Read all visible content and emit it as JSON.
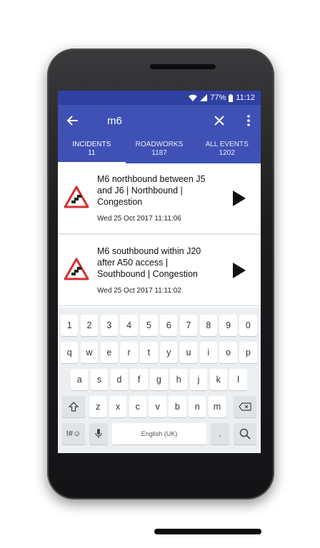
{
  "status": {
    "battery": "77%",
    "time": "11:12"
  },
  "appbar": {
    "query": "m6",
    "back_icon": "arrow-left-icon",
    "clear_icon": "close-icon",
    "more_icon": "more-vert-icon"
  },
  "tabs": [
    {
      "label": "INCIDENTS",
      "count": "11"
    },
    {
      "label": "ROADWORKS",
      "count": "1187"
    },
    {
      "label": "ALL EVENTS",
      "count": "1202"
    }
  ],
  "incidents": [
    {
      "title": "M6 northbound between J5 and J6 | Northbound | Congestion",
      "timestamp": "Wed 25 Oct 2017 11:11:06",
      "icon": "queue-warning-icon"
    },
    {
      "title": "M6 southbound within J20 after A50 access | Southbound | Congestion",
      "timestamp": "Wed 25 Oct 2017 11:11:02",
      "icon": "queue-warning-icon"
    }
  ],
  "keyboard": {
    "row1": [
      "1",
      "2",
      "3",
      "4",
      "5",
      "6",
      "7",
      "8",
      "9",
      "0"
    ],
    "row2": [
      "q",
      "w",
      "e",
      "r",
      "t",
      "y",
      "u",
      "i",
      "o",
      "p"
    ],
    "row3": [
      "a",
      "s",
      "d",
      "f",
      "g",
      "h",
      "j",
      "k",
      "l"
    ],
    "row4": [
      "z",
      "x",
      "c",
      "v",
      "b",
      "n",
      "m"
    ],
    "symbols": "!#☺",
    "space": "English (UK)",
    "period": ".",
    "shift_icon": "shift-icon",
    "backspace_icon": "backspace-icon",
    "mic_icon": "mic-icon",
    "search_icon": "search-icon"
  },
  "colors": {
    "primary": "#3f51b5",
    "primary_dark": "#2f40a3",
    "warning_red": "#d32f2f"
  }
}
